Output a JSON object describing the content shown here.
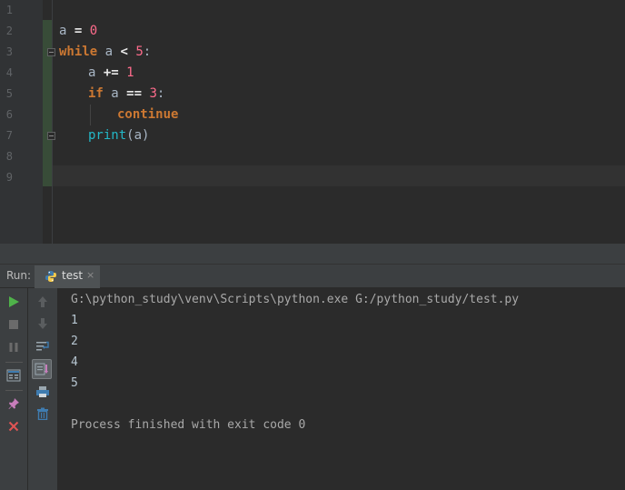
{
  "editor": {
    "line_numbers": [
      "1",
      "2",
      "3",
      "4",
      "5",
      "6",
      "7",
      "8",
      "9"
    ],
    "code": {
      "l2": {
        "a": "a",
        "eq": "=",
        "zero": "0"
      },
      "l3": {
        "kw": "while",
        "a": "a",
        "lt": "<",
        "five": "5",
        "colon": ":"
      },
      "l4": {
        "a": "a",
        "pluseq": "+=",
        "one": "1"
      },
      "l5": {
        "kw": "if",
        "a": "a",
        "eqeq": "==",
        "three": "3",
        "colon": ":"
      },
      "l6": {
        "kw": "continue"
      },
      "l7": {
        "fn": "print",
        "args": "(a)"
      }
    },
    "colors": {
      "keyword": "#cc7832",
      "number": "#ff6c8c",
      "builtin": "#23b8c8",
      "text": "#a9b7c6"
    }
  },
  "run_panel": {
    "label": "Run:",
    "tab": {
      "label": "test",
      "icon": "python-icon",
      "close": "×"
    },
    "toolbar_left": [
      "run-icon",
      "stop-icon",
      "pause-icon",
      "layout-icon",
      "pin-icon",
      "close-icon"
    ],
    "toolbar_second": [
      "up-arrow-icon",
      "down-arrow-icon",
      "soft-wrap-icon",
      "scroll-to-end-icon",
      "print-icon",
      "trash-icon"
    ]
  },
  "console": {
    "command": "G:\\python_study\\venv\\Scripts\\python.exe G:/python_study/test.py",
    "outputs": [
      "1",
      "2",
      "4",
      "5"
    ],
    "process_finished": "Process finished with exit code 0"
  }
}
